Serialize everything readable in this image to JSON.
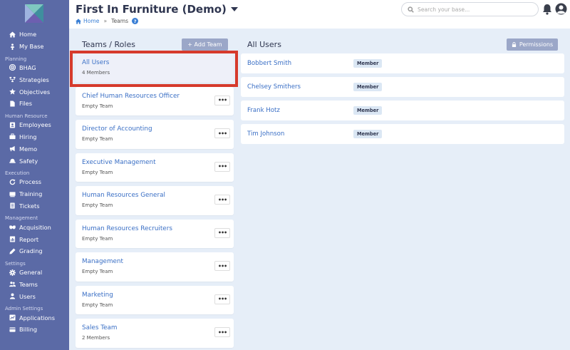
{
  "sidebar": {
    "items": [
      {
        "type": "item",
        "label": "Home",
        "icon": "home-icon"
      },
      {
        "type": "item",
        "label": "My Base",
        "icon": "person-icon"
      },
      {
        "type": "section",
        "label": "Planning"
      },
      {
        "type": "item",
        "label": "BHAG",
        "icon": "target-icon"
      },
      {
        "type": "item",
        "label": "Strategies",
        "icon": "strategy-icon"
      },
      {
        "type": "item",
        "label": "Objectives",
        "icon": "star-icon"
      },
      {
        "type": "item",
        "label": "Files",
        "icon": "file-icon"
      },
      {
        "type": "section",
        "label": "Human Resource"
      },
      {
        "type": "item",
        "label": "Employees",
        "icon": "id-card-icon"
      },
      {
        "type": "item",
        "label": "Hiring",
        "icon": "briefcase-icon"
      },
      {
        "type": "item",
        "label": "Memo",
        "icon": "megaphone-icon"
      },
      {
        "type": "item",
        "label": "Safety",
        "icon": "hardhat-icon"
      },
      {
        "type": "section",
        "label": "Execution"
      },
      {
        "type": "item",
        "label": "Process",
        "icon": "refresh-icon"
      },
      {
        "type": "item",
        "label": "Training",
        "icon": "training-icon"
      },
      {
        "type": "item",
        "label": "Tickets",
        "icon": "ticket-icon"
      },
      {
        "type": "section",
        "label": "Management"
      },
      {
        "type": "item",
        "label": "Acquisition",
        "icon": "handshake-icon"
      },
      {
        "type": "item",
        "label": "Report",
        "icon": "report-icon"
      },
      {
        "type": "item",
        "label": "Grading",
        "icon": "pen-icon"
      },
      {
        "type": "section",
        "label": "Settings"
      },
      {
        "type": "item",
        "label": "General",
        "icon": "gear-icon"
      },
      {
        "type": "item",
        "label": "Teams",
        "icon": "users-icon"
      },
      {
        "type": "item",
        "label": "Users",
        "icon": "user-icon"
      },
      {
        "type": "section",
        "label": "Admin Settings"
      },
      {
        "type": "item",
        "label": "Applications",
        "icon": "chart-icon"
      },
      {
        "type": "item",
        "label": "Billing",
        "icon": "billing-icon"
      }
    ]
  },
  "header": {
    "title": "First In Furniture (Demo)",
    "breadcrumb_home": "Home",
    "breadcrumb_separator": "»",
    "breadcrumb_current": "Teams",
    "help_glyph": "?",
    "search_placeholder": "Search your base..."
  },
  "teams_panel": {
    "title": "Teams / Roles",
    "add_label": "+ Add Team",
    "more_glyph": "•••",
    "teams": [
      {
        "name": "All Users",
        "sub": "4 Members",
        "selected": true
      },
      {
        "name": "Chief Human Resources Officer",
        "sub": "Empty Team"
      },
      {
        "name": "Director of Accounting",
        "sub": "Empty Team"
      },
      {
        "name": "Executive Management",
        "sub": "Empty Team"
      },
      {
        "name": "Human Resources General",
        "sub": "Empty Team"
      },
      {
        "name": "Human Resources Recruiters",
        "sub": "Empty Team"
      },
      {
        "name": "Management",
        "sub": "Empty Team"
      },
      {
        "name": "Marketing",
        "sub": "Empty Team"
      },
      {
        "name": "Sales Team",
        "sub": "2 Members"
      }
    ]
  },
  "users_panel": {
    "title": "All Users",
    "permissions_label": "Permissions",
    "users": [
      {
        "name": "Bobbert Smith",
        "role": "Member"
      },
      {
        "name": "Chelsey Smithers",
        "role": "Member"
      },
      {
        "name": "Frank Hotz",
        "role": "Member"
      },
      {
        "name": "Tim Johnson",
        "role": "Member"
      }
    ]
  },
  "colors": {
    "sidebar": "#5b6aa6",
    "accent": "#3a6fc5",
    "highlight": "#d63a2c",
    "background": "#e6eef8"
  }
}
